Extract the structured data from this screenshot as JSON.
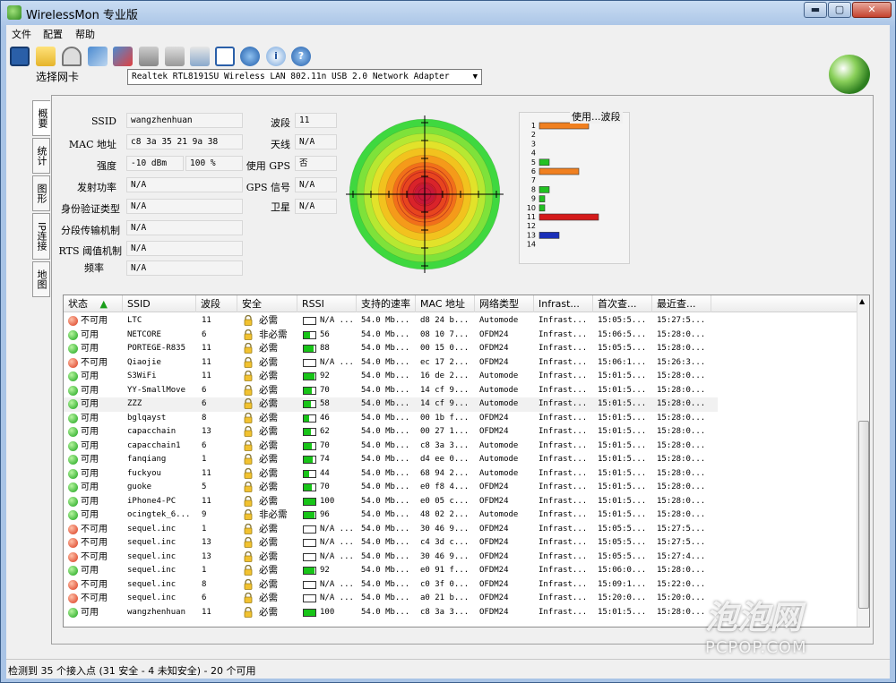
{
  "window": {
    "title": "WirelessMon 专业版",
    "min": "▬",
    "max": "▢",
    "close": "✕"
  },
  "menu": [
    "文件",
    "配置",
    "帮助"
  ],
  "toolbar": [
    "save-icon",
    "open-folder-icon",
    "gauge-icon",
    "network-icon",
    "disconnect-icon",
    "printer-icon",
    "printer-settings-icon",
    "export-icon",
    "checklist-icon",
    "globe-icon",
    "info-icon",
    "help-icon"
  ],
  "adapter": {
    "label": "选择网卡",
    "value": "Realtek RTL8191SU Wireless LAN 802.11n USB 2.0 Network Adapter"
  },
  "tabs": [
    "概要",
    "统计",
    "图形",
    "IP连接",
    "地图"
  ],
  "fields": {
    "ssid_label": "SSID",
    "ssid": "wangzhenhuan",
    "mac_label": "MAC 地址",
    "mac": "c8 3a 35 21 9a 38",
    "strength_label": "强度",
    "strength_dbm": "-10 dBm",
    "strength_pct": "100 %",
    "tx_label": "发射功率",
    "tx": "N/A",
    "auth_label": "身份验证类型",
    "auth": "N/A",
    "frag_label": "分段传输机制",
    "frag": "N/A",
    "rts_label": "RTS 阈值机制",
    "rts": "N/A",
    "freq_label": "频率",
    "freq": "N/A",
    "channel_label": "波段",
    "channel": "11",
    "antenna_label": "天线",
    "antenna": "N/A",
    "gps_use_label": "使用 GPS",
    "gps_use": "否",
    "gps_signal_label": "GPS 信号",
    "gps_signal": "N/A",
    "sat_label": "卫星",
    "sat": "N/A"
  },
  "colors": {
    "ring_colors": [
      "#3fd83f",
      "#7ee23a",
      "#b6e832",
      "#e2e22a",
      "#f2c21e",
      "#f59a1a",
      "#f26f1a",
      "#e8451e",
      "#d9232a",
      "#c81838"
    ]
  },
  "chart_data": {
    "type": "bar",
    "title": "使用...波段",
    "categories": [
      "1",
      "2",
      "3",
      "4",
      "5",
      "6",
      "7",
      "8",
      "9",
      "10",
      "11",
      "12",
      "13",
      "14"
    ],
    "values": [
      5,
      0,
      0,
      0,
      1,
      4,
      0,
      1,
      0.5,
      0.5,
      6,
      0,
      2,
      0
    ],
    "bar_colors": [
      "#f08020",
      "",
      "",
      "",
      "#22c122",
      "#f08020",
      "",
      "#22c122",
      "#22c122",
      "#22c122",
      "#d41a1a",
      "",
      "#1a2fb8",
      ""
    ]
  },
  "table": {
    "headers": [
      "状态",
      "SSID",
      "波段",
      "安全",
      "RSSI",
      "支持的速率",
      "MAC 地址",
      "网络类型",
      "Infrast...",
      "首次查...",
      "最近查..."
    ],
    "sort_arrow": "▲",
    "rows": [
      {
        "status": "不可用",
        "ok": false,
        "ssid": "LTC",
        "ch": "11",
        "sec": "必需",
        "rssi": "N/A ...",
        "sig": 0,
        "rate": "54.0 Mb...",
        "mac": "d8 24 b...",
        "net": "Automode",
        "infra": "Infrast...",
        "first": "15:05:5...",
        "last": "15:27:5..."
      },
      {
        "status": "可用",
        "ok": true,
        "ssid": "NETCORE",
        "ch": "6",
        "sec": "非必需",
        "rssi": "56",
        "sig": 0.56,
        "rate": "54.0 Mb...",
        "mac": "08 10 7...",
        "net": "OFDM24",
        "infra": "Infrast...",
        "first": "15:06:5...",
        "last": "15:28:0..."
      },
      {
        "status": "可用",
        "ok": true,
        "ssid": "PORTEGE-R835",
        "ch": "11",
        "sec": "必需",
        "rssi": "88",
        "sig": 0.88,
        "rate": "54.0 Mb...",
        "mac": "00 15 0...",
        "net": "OFDM24",
        "infra": "Infrast...",
        "first": "15:05:5...",
        "last": "15:28:0..."
      },
      {
        "status": "不可用",
        "ok": false,
        "ssid": "Qiaojie",
        "ch": "11",
        "sec": "必需",
        "rssi": "N/A ...",
        "sig": 0,
        "rate": "54.0 Mb...",
        "mac": "ec 17 2...",
        "net": "OFDM24",
        "infra": "Infrast...",
        "first": "15:06:1...",
        "last": "15:26:3..."
      },
      {
        "status": "可用",
        "ok": true,
        "ssid": "S3WiFi",
        "ch": "11",
        "sec": "必需",
        "rssi": "92",
        "sig": 0.92,
        "rate": "54.0 Mb...",
        "mac": "16 de 2...",
        "net": "Automode",
        "infra": "Infrast...",
        "first": "15:01:5...",
        "last": "15:28:0..."
      },
      {
        "status": "可用",
        "ok": true,
        "ssid": "YY-SmallMove",
        "ch": "6",
        "sec": "必需",
        "rssi": "70",
        "sig": 0.7,
        "rate": "54.0 Mb...",
        "mac": "14 cf 9...",
        "net": "Automode",
        "infra": "Infrast...",
        "first": "15:01:5...",
        "last": "15:28:0..."
      },
      {
        "status": "可用",
        "ok": true,
        "ssid": "ZZZ",
        "ch": "6",
        "sec": "必需",
        "rssi": "58",
        "sig": 0.58,
        "rate": "54.0 Mb...",
        "mac": "14 cf 9...",
        "net": "Automode",
        "infra": "Infrast...",
        "first": "15:01:5...",
        "last": "15:28:0..."
      },
      {
        "status": "可用",
        "ok": true,
        "ssid": "bglqayst",
        "ch": "8",
        "sec": "必需",
        "rssi": "46",
        "sig": 0.46,
        "rate": "54.0 Mb...",
        "mac": "00 1b f...",
        "net": "OFDM24",
        "infra": "Infrast...",
        "first": "15:01:5...",
        "last": "15:28:0..."
      },
      {
        "status": "可用",
        "ok": true,
        "ssid": "capacchain",
        "ch": "13",
        "sec": "必需",
        "rssi": "62",
        "sig": 0.62,
        "rate": "54.0 Mb...",
        "mac": "00 27 1...",
        "net": "OFDM24",
        "infra": "Infrast...",
        "first": "15:01:5...",
        "last": "15:28:0..."
      },
      {
        "status": "可用",
        "ok": true,
        "ssid": "capacchain1",
        "ch": "6",
        "sec": "必需",
        "rssi": "70",
        "sig": 0.7,
        "rate": "54.0 Mb...",
        "mac": "c8 3a 3...",
        "net": "Automode",
        "infra": "Infrast...",
        "first": "15:01:5...",
        "last": "15:28:0..."
      },
      {
        "status": "可用",
        "ok": true,
        "ssid": "fanqiang",
        "ch": "1",
        "sec": "必需",
        "rssi": "74",
        "sig": 0.74,
        "rate": "54.0 Mb...",
        "mac": "d4 ee 0...",
        "net": "Automode",
        "infra": "Infrast...",
        "first": "15:01:5...",
        "last": "15:28:0..."
      },
      {
        "status": "可用",
        "ok": true,
        "ssid": "fuckyou",
        "ch": "11",
        "sec": "必需",
        "rssi": "44",
        "sig": 0.44,
        "rate": "54.0 Mb...",
        "mac": "68 94 2...",
        "net": "Automode",
        "infra": "Infrast...",
        "first": "15:01:5...",
        "last": "15:28:0..."
      },
      {
        "status": "可用",
        "ok": true,
        "ssid": "guoke",
        "ch": "5",
        "sec": "必需",
        "rssi": "70",
        "sig": 0.7,
        "rate": "54.0 Mb...",
        "mac": "e0 f8 4...",
        "net": "OFDM24",
        "infra": "Infrast...",
        "first": "15:01:5...",
        "last": "15:28:0..."
      },
      {
        "status": "可用",
        "ok": true,
        "ssid": "iPhone4-PC",
        "ch": "11",
        "sec": "必需",
        "rssi": "100",
        "sig": 1,
        "rate": "54.0 Mb...",
        "mac": "e0 05 c...",
        "net": "OFDM24",
        "infra": "Infrast...",
        "first": "15:01:5...",
        "last": "15:28:0..."
      },
      {
        "status": "可用",
        "ok": true,
        "ssid": "ocingtek_6...",
        "ch": "9",
        "sec": "非必需",
        "rssi": "96",
        "sig": 0.96,
        "rate": "54.0 Mb...",
        "mac": "48 02 2...",
        "net": "Automode",
        "infra": "Infrast...",
        "first": "15:01:5...",
        "last": "15:28:0..."
      },
      {
        "status": "不可用",
        "ok": false,
        "ssid": "sequel.inc",
        "ch": "1",
        "sec": "必需",
        "rssi": "N/A ...",
        "sig": 0,
        "rate": "54.0 Mb...",
        "mac": "30 46 9...",
        "net": "OFDM24",
        "infra": "Infrast...",
        "first": "15:05:5...",
        "last": "15:27:5..."
      },
      {
        "status": "不可用",
        "ok": false,
        "ssid": "sequel.inc",
        "ch": "13",
        "sec": "必需",
        "rssi": "N/A ...",
        "sig": 0,
        "rate": "54.0 Mb...",
        "mac": "c4 3d c...",
        "net": "OFDM24",
        "infra": "Infrast...",
        "first": "15:05:5...",
        "last": "15:27:5..."
      },
      {
        "status": "不可用",
        "ok": false,
        "ssid": "sequel.inc",
        "ch": "13",
        "sec": "必需",
        "rssi": "N/A ...",
        "sig": 0,
        "rate": "54.0 Mb...",
        "mac": "30 46 9...",
        "net": "OFDM24",
        "infra": "Infrast...",
        "first": "15:05:5...",
        "last": "15:27:4..."
      },
      {
        "status": "可用",
        "ok": true,
        "ssid": "sequel.inc",
        "ch": "1",
        "sec": "必需",
        "rssi": "92",
        "sig": 0.92,
        "rate": "54.0 Mb...",
        "mac": "e0 91 f...",
        "net": "OFDM24",
        "infra": "Infrast...",
        "first": "15:06:0...",
        "last": "15:28:0..."
      },
      {
        "status": "不可用",
        "ok": false,
        "ssid": "sequel.inc",
        "ch": "8",
        "sec": "必需",
        "rssi": "N/A ...",
        "sig": 0,
        "rate": "54.0 Mb...",
        "mac": "c0 3f 0...",
        "net": "OFDM24",
        "infra": "Infrast...",
        "first": "15:09:1...",
        "last": "15:22:0..."
      },
      {
        "status": "不可用",
        "ok": false,
        "ssid": "sequel.inc",
        "ch": "6",
        "sec": "必需",
        "rssi": "N/A ...",
        "sig": 0,
        "rate": "54.0 Mb...",
        "mac": "a0 21 b...",
        "net": "OFDM24",
        "infra": "Infrast...",
        "first": "15:20:0...",
        "last": "15:20:0..."
      },
      {
        "status": "可用",
        "ok": true,
        "ssid": "wangzhenhuan",
        "ch": "11",
        "sec": "必需",
        "rssi": "100",
        "sig": 1,
        "rate": "54.0 Mb...",
        "mac": "c8 3a 3...",
        "net": "OFDM24",
        "infra": "Infrast...",
        "first": "15:01:5...",
        "last": "15:28:0..."
      }
    ]
  },
  "status_bar": "检测到 35 个接入点 (31 安全 - 4 未知安全) - 20 个可用",
  "watermark": {
    "big": "泡泡网",
    "small": "PCPOP.COM"
  }
}
